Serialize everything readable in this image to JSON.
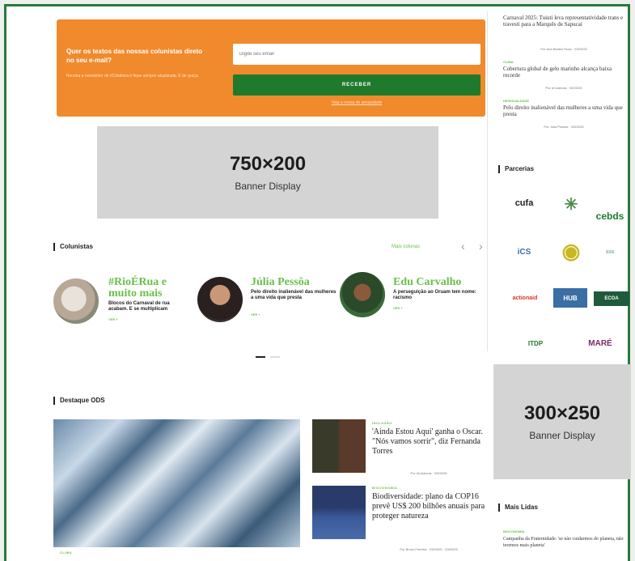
{
  "newsletter": {
    "title": "Quer os textos das nossas colunistas direto no seu e-mail?",
    "subtitle": "Receba a newsletter do #Colabora e fique sempre atualizada. É de graça.",
    "email_placeholder": "Digite seu email",
    "button_label": "RECEBER",
    "link_label": "Veja a nossa de privacidade"
  },
  "banner_top": {
    "size": "750×200",
    "label": "Banner Display"
  },
  "banner_side": {
    "size": "300×250",
    "label": "Banner Display"
  },
  "columnists": {
    "title": "Colunistas",
    "more_label": "Mais colunas",
    "prev_icon": "‹",
    "next_icon": "›",
    "items": [
      {
        "name": "#RioÉRua e muito mais",
        "desc": "Blocos do Carnaval de rua acabam. E se multiplicam",
        "tag": "VER +"
      },
      {
        "name": "Júlia Pessôa",
        "desc": "Pelo direito inalienável das mulheres a uma vida que presta",
        "tag": "VER +"
      },
      {
        "name": "Edu Carvalho",
        "desc": "A perseguição ao Oruam tem nome: racismo",
        "tag": "VER +"
      }
    ]
  },
  "ods": {
    "title": "Destaque ODS",
    "main_tag": "CLIMA",
    "articles": [
      {
        "tag": "INCLUSÃO",
        "title": "'Ainda Estou Aqui' ganha o Oscar. \"Nós vamos sorrir\", diz Fernanda Torres",
        "meta": "Por #Colabora · 03/03/25"
      },
      {
        "tag": "BIOCONOMIA",
        "title": "Biodiversidade: plano da COP16 prevê US$ 200 bilhões anuais para proteger natureza",
        "meta": "Por Bruno Ferreira · 03/03/25 · 03/03/25"
      }
    ]
  },
  "sidebar": {
    "news": [
      {
        "title": "Carnaval 2025: Tuiuti leva representatividade trans e travesti para a Marquês de Sapucaí",
        "meta": "Por Ana Beatriz Rosa · 03/03/25",
        "tag": ""
      },
      {
        "title": "Cobertura global de gelo marinho alcança baixa recorde",
        "meta": "Por #Colabora · 03/03/25",
        "tag": "CLIMA"
      },
      {
        "title": "Pelo direito inalienável das mulheres a uma vida que presta",
        "meta": "Por Júlia Pessôa · 03/03/25",
        "tag": "DESIGUALDADE"
      }
    ],
    "partners_title": "Parcerias",
    "partners": [
      {
        "label": "cufa",
        "color": "#222"
      },
      {
        "label": "✳",
        "color": "#4a8a4a"
      },
      {
        "label": "cebds",
        "color": "#1f7a2e"
      },
      {
        "label": "iCS",
        "color": "#3a6ea5"
      },
      {
        "label": "◉",
        "color": "#c8b820"
      },
      {
        "label": "≡≡≡",
        "color": "#2a7a3a"
      },
      {
        "label": "actionaid",
        "color": "#d03a2a"
      },
      {
        "label": "HUB",
        "color": "#3a6ea5"
      },
      {
        "label": "ECOA",
        "color": "#1f5a3a"
      },
      {
        "label": "ITDP",
        "color": "#1f7a2e"
      },
      {
        "label": "MARÉ",
        "color": "#7a2a6a"
      }
    ],
    "most_read_title": "Mais Lidas",
    "most_read": [
      {
        "tag": "BIOCONOMIA",
        "title": "Campanha da Fraternidade: 'se não cuidarmos do planeta, não teremos mais planeta'"
      }
    ]
  }
}
